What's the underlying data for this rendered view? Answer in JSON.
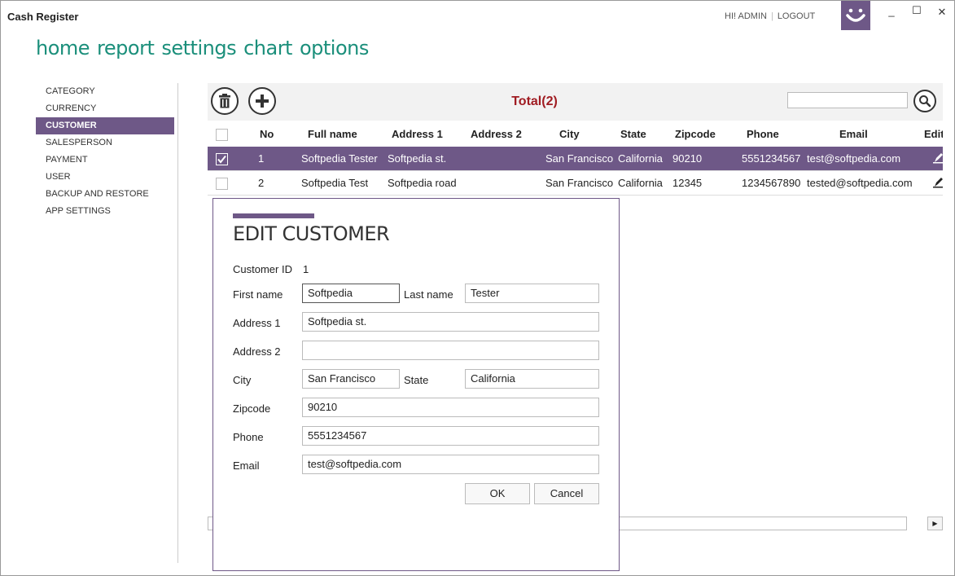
{
  "app": {
    "title": "Cash Register",
    "greeting": "HI! ADMIN",
    "logout": "LOGOUT",
    "min": "_",
    "max": "☐",
    "close": "✕"
  },
  "nav": [
    "home",
    "report",
    "settings",
    "chart",
    "options"
  ],
  "sidebar": [
    "CATEGORY",
    "CURRENCY",
    "CUSTOMER",
    "SALESPERSON",
    "PAYMENT",
    "USER",
    "BACKUP AND RESTORE",
    "APP SETTINGS"
  ],
  "sidebar_active": "CUSTOMER",
  "toolbar": {
    "total": "Total(2)",
    "delete_icon": "trash-icon",
    "add_icon": "plus-icon",
    "search_icon": "search-icon"
  },
  "table": {
    "headers": [
      "No",
      "Full name",
      "Address 1",
      "Address 2",
      "City",
      "State",
      "Zipcode",
      "Phone",
      "Email",
      "Edit"
    ],
    "rows": [
      {
        "checked": true,
        "no": "1",
        "full_name": "Softpedia Tester",
        "address1": "Softpedia st.",
        "address2": "",
        "city": "San Francisco",
        "state": "California",
        "zipcode": "90210",
        "phone": "5551234567",
        "email": "test@softpedia.com"
      },
      {
        "checked": false,
        "no": "2",
        "full_name": "Softpedia Test",
        "address1": "Softpedia road",
        "address2": "",
        "city": "San Francisco",
        "state": "California",
        "zipcode": "12345",
        "phone": "1234567890",
        "email": "tested@softpedia.com"
      }
    ]
  },
  "dialog": {
    "title": "EDIT CUSTOMER",
    "customer_id_label": "Customer ID",
    "customer_id": "1",
    "first_name_label": "First name",
    "first_name": "Softpedia",
    "last_name_label": "Last name",
    "last_name": "Tester",
    "address1_label": "Address 1",
    "address1": "Softpedia st.",
    "address2_label": "Address 2",
    "address2": "",
    "city_label": "City",
    "city": "San Francisco",
    "state_label": "State",
    "state": "California",
    "zipcode_label": "Zipcode",
    "zipcode": "90210",
    "phone_label": "Phone",
    "phone": "5551234567",
    "email_label": "Email",
    "email": "test@softpedia.com",
    "ok": "OK",
    "cancel": "Cancel"
  },
  "colors": {
    "accent": "#6e5887",
    "nav": "#1b8f7b",
    "total": "#a01c22"
  }
}
